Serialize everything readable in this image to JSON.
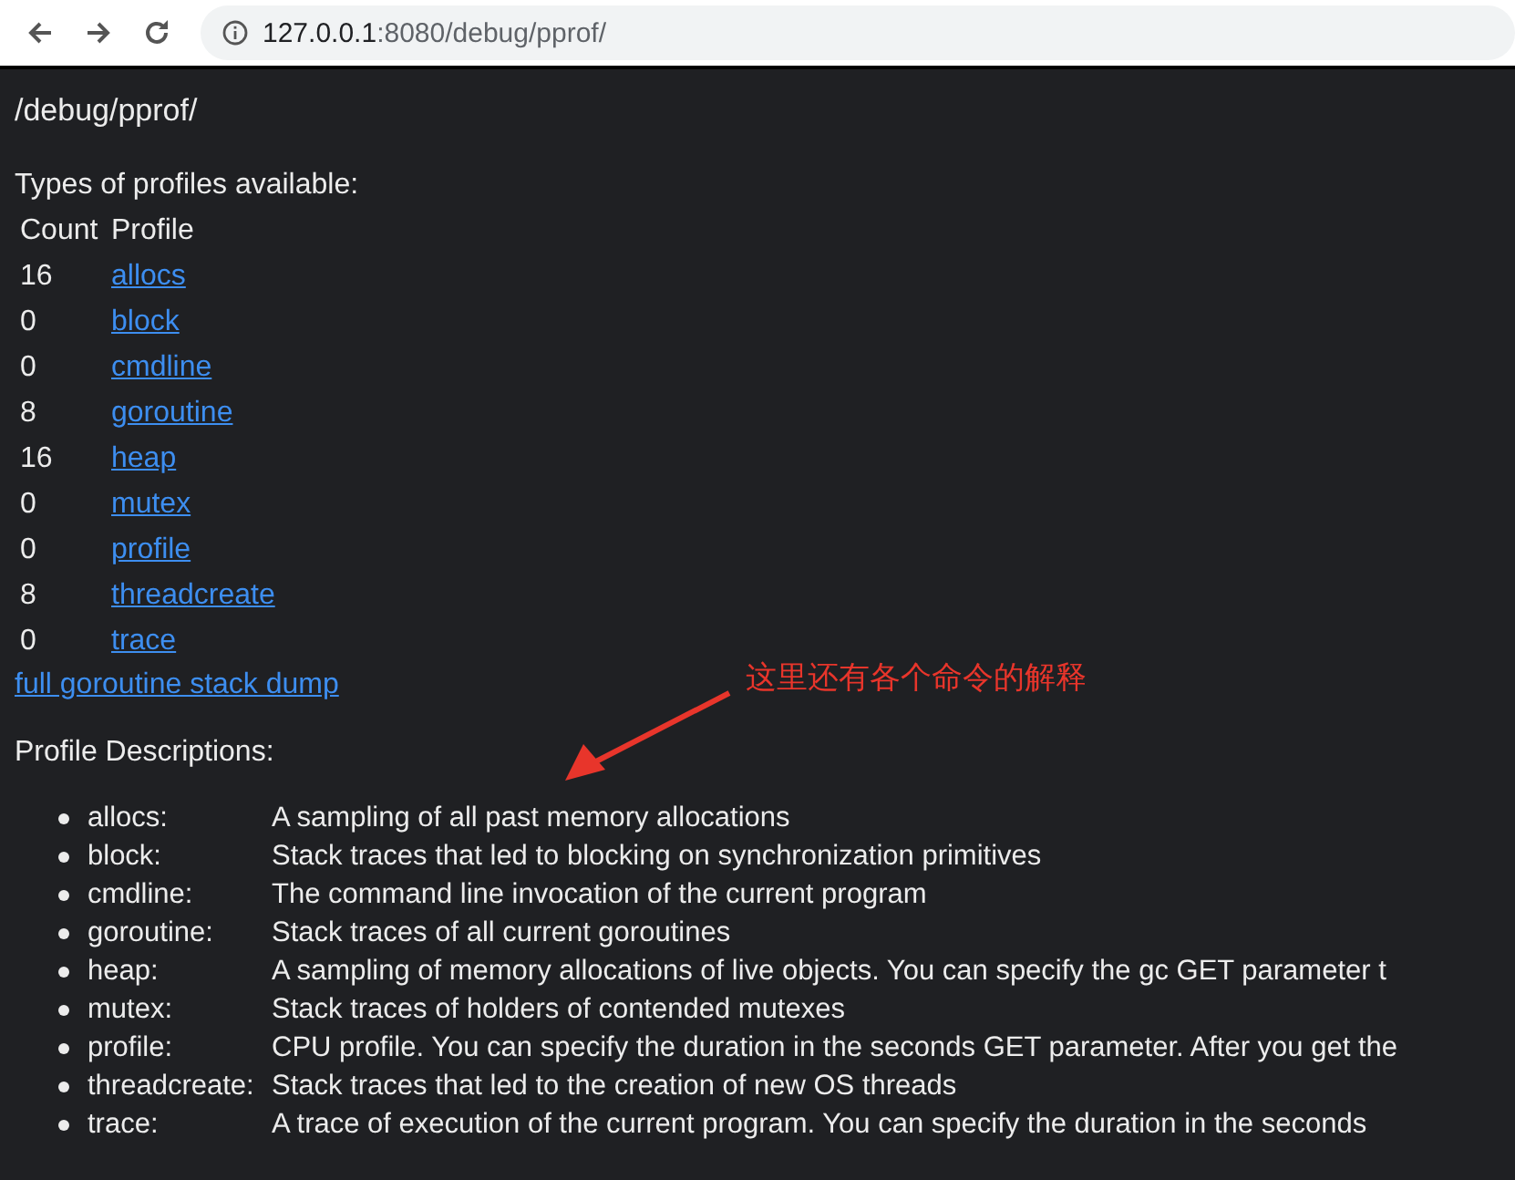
{
  "browser": {
    "url_host": "127.0.0.1",
    "url_rest": ":8080/debug/pprof/"
  },
  "page": {
    "heading": "/debug/pprof/",
    "intro": "Types of profiles available:",
    "table": {
      "columns": [
        "Count",
        "Profile"
      ],
      "rows": [
        {
          "count": "16",
          "profile": "allocs"
        },
        {
          "count": "0",
          "profile": "block"
        },
        {
          "count": "0",
          "profile": "cmdline"
        },
        {
          "count": "8",
          "profile": "goroutine"
        },
        {
          "count": "16",
          "profile": "heap"
        },
        {
          "count": "0",
          "profile": "mutex"
        },
        {
          "count": "0",
          "profile": "profile"
        },
        {
          "count": "8",
          "profile": "threadcreate"
        },
        {
          "count": "0",
          "profile": "trace"
        }
      ]
    },
    "dump_link": "full goroutine stack dump",
    "descriptions_title": "Profile Descriptions:",
    "descriptions": [
      {
        "name": "allocs:",
        "text": "A sampling of all past memory allocations"
      },
      {
        "name": "block:",
        "text": "Stack traces that led to blocking on synchronization primitives"
      },
      {
        "name": "cmdline:",
        "text": "The command line invocation of the current program"
      },
      {
        "name": "goroutine:",
        "text": "Stack traces of all current goroutines"
      },
      {
        "name": "heap:",
        "text": "A sampling of memory allocations of live objects. You can specify the gc GET parameter t"
      },
      {
        "name": "mutex:",
        "text": "Stack traces of holders of contended mutexes"
      },
      {
        "name": "profile:",
        "text": "CPU profile. You can specify the duration in the seconds GET parameter. After you get the"
      },
      {
        "name": "threadcreate:",
        "text": "Stack traces that led to the creation of new OS threads"
      },
      {
        "name": "trace:",
        "text": "A trace of execution of the current program. You can specify the duration in the seconds"
      }
    ]
  },
  "annotation": {
    "text": "这里还有各个命令的解释"
  }
}
